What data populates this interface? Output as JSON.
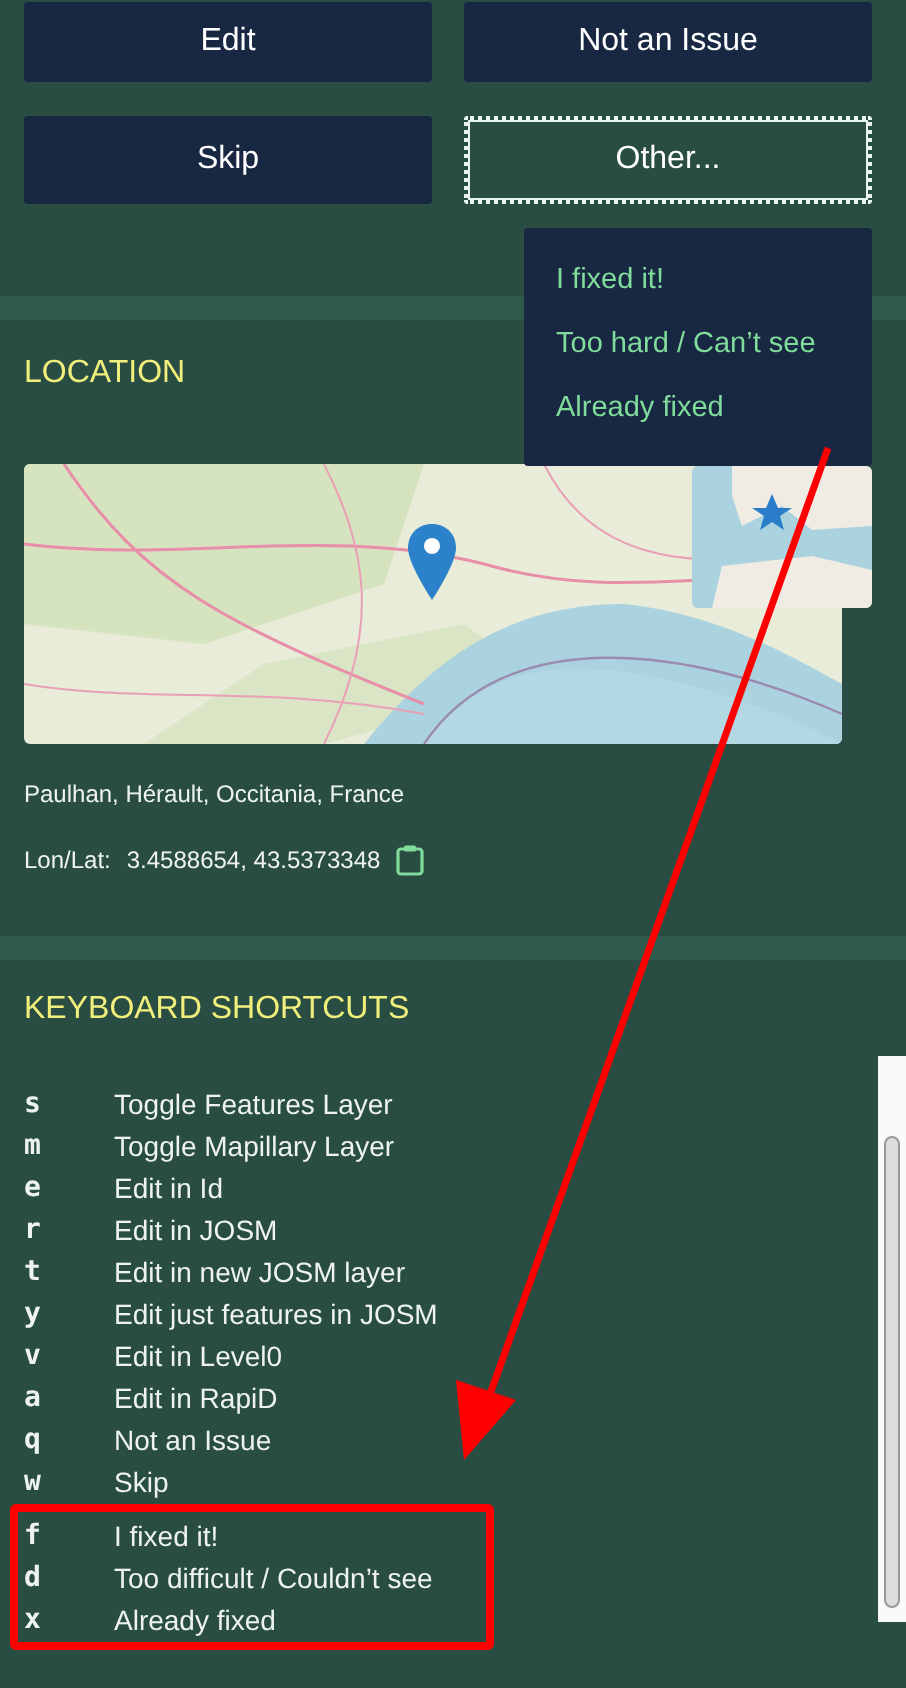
{
  "actions": [
    {
      "label": "Edit",
      "kind": "filled"
    },
    {
      "label": "Not an Issue",
      "kind": "filled"
    },
    {
      "label": "Skip",
      "kind": "filled"
    },
    {
      "label": "Other...",
      "kind": "outlined"
    }
  ],
  "other_menu": {
    "items": [
      "I fixed it!",
      "Too hard / Can’t see",
      "Already fixed"
    ]
  },
  "location": {
    "title": "LOCATION",
    "address": "Paulhan, Hérault, Occitania, France",
    "lonlat_label": "Lon/Lat:",
    "lonlat_value": "3.4588654, 43.5373348"
  },
  "shortcuts": {
    "title": "KEYBOARD SHORTCUTS",
    "items": [
      {
        "key": "s",
        "action": "Toggle Features Layer",
        "highlighted": false
      },
      {
        "key": "m",
        "action": "Toggle Mapillary Layer",
        "highlighted": false
      },
      {
        "key": "e",
        "action": "Edit in Id",
        "highlighted": false
      },
      {
        "key": "r",
        "action": "Edit in JOSM",
        "highlighted": false
      },
      {
        "key": "t",
        "action": "Edit in new JOSM layer",
        "highlighted": false
      },
      {
        "key": "y",
        "action": "Edit just features in JOSM",
        "highlighted": false
      },
      {
        "key": "v",
        "action": "Edit in Level0",
        "highlighted": false
      },
      {
        "key": "a",
        "action": "Edit in RapiD",
        "highlighted": false
      },
      {
        "key": "q",
        "action": "Not an Issue",
        "highlighted": false
      },
      {
        "key": "w",
        "action": "Skip",
        "highlighted": false
      },
      {
        "key": "f",
        "action": "I fixed it!",
        "highlighted": true
      },
      {
        "key": "d",
        "action": "Too difficult / Couldn’t see",
        "highlighted": true
      },
      {
        "key": "x",
        "action": "Already fixed",
        "highlighted": true
      }
    ]
  }
}
